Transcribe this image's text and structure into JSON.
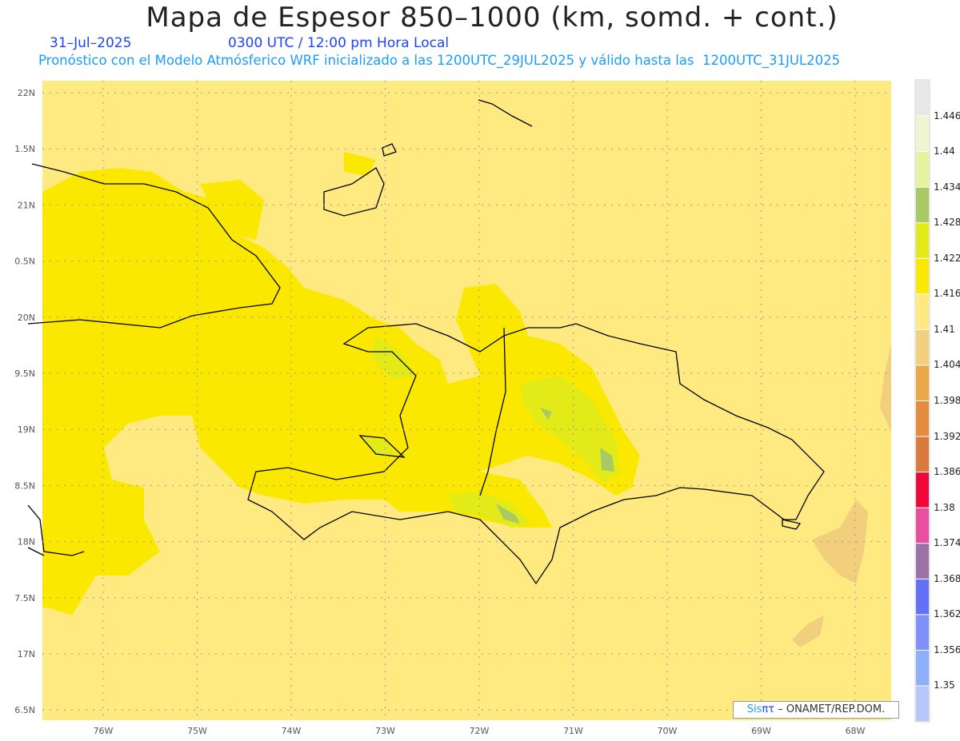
{
  "title": "Mapa de Espesor 850–1000 (km, somd. + cont.)",
  "date": "31–Jul–2025",
  "time": "0300 UTC / 12:00 pm Hora Local",
  "subtitle": "Pronóstico con el Modelo Atmósferico WRF inicializado a las 1200UTC_29JUL2025 y válido hasta las  1200UTC_31JUL2025",
  "lon_labels": [
    "76W",
    "75W",
    "74W",
    "73W",
    "72W",
    "71W",
    "70W",
    "69W",
    "68W"
  ],
  "lat_labels": [
    "22N",
    "1.5N",
    "21N",
    "0.5N",
    "20N",
    "9.5N",
    "19N",
    "8.5N",
    "18N",
    "7.5N",
    "17N",
    "6.5N"
  ],
  "colorbar": {
    "labels": [
      "1.446",
      "1.44",
      "1.434",
      "1.428",
      "1.422",
      "1.416",
      "1.41",
      "1.404",
      "1.398",
      "1.392",
      "1.386",
      "1.38",
      "1.374",
      "1.368",
      "1.362",
      "1.356",
      "1.35"
    ],
    "colors": [
      "#e8e8e8",
      "#eef5d0",
      "#e5f29e",
      "#a8c964",
      "#e2ea17",
      "#fbe800",
      "#feea80",
      "#f2cf7c",
      "#eba64a",
      "#e58c3c",
      "#d97a3c",
      "#ef073c",
      "#e84f9e",
      "#9a72a6",
      "#6470f5",
      "#7d90fb",
      "#8daefc",
      "#b6c6fb"
    ]
  },
  "credit": {
    "sis": "Sis",
    "pi": "πτ",
    "rest": "–  ONAMET/REP.DOM."
  }
}
